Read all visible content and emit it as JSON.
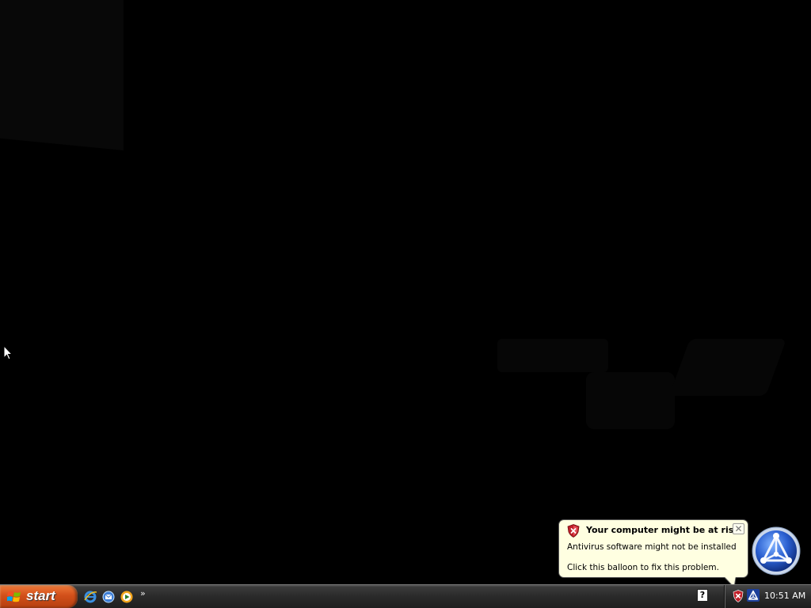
{
  "taskbar": {
    "start_label": "start",
    "quick_launch": [
      {
        "icon": "internet-explorer-icon"
      },
      {
        "icon": "outlook-express-icon"
      },
      {
        "icon": "media-player-icon"
      }
    ],
    "overflow_label": "»"
  },
  "tray": {
    "help_label": "?",
    "clock": "10:51 AM"
  },
  "balloon": {
    "title": "Your computer might be at risk",
    "close_label": "✕",
    "line1": "Antivirus software might not be installed",
    "line2": "Click this balloon to fix this problem."
  },
  "colors": {
    "start_orange": "#d2501a",
    "balloon_bg": "#ffffe1",
    "taskbar": "#2a2a2a",
    "alert_red": "#c0202a"
  }
}
